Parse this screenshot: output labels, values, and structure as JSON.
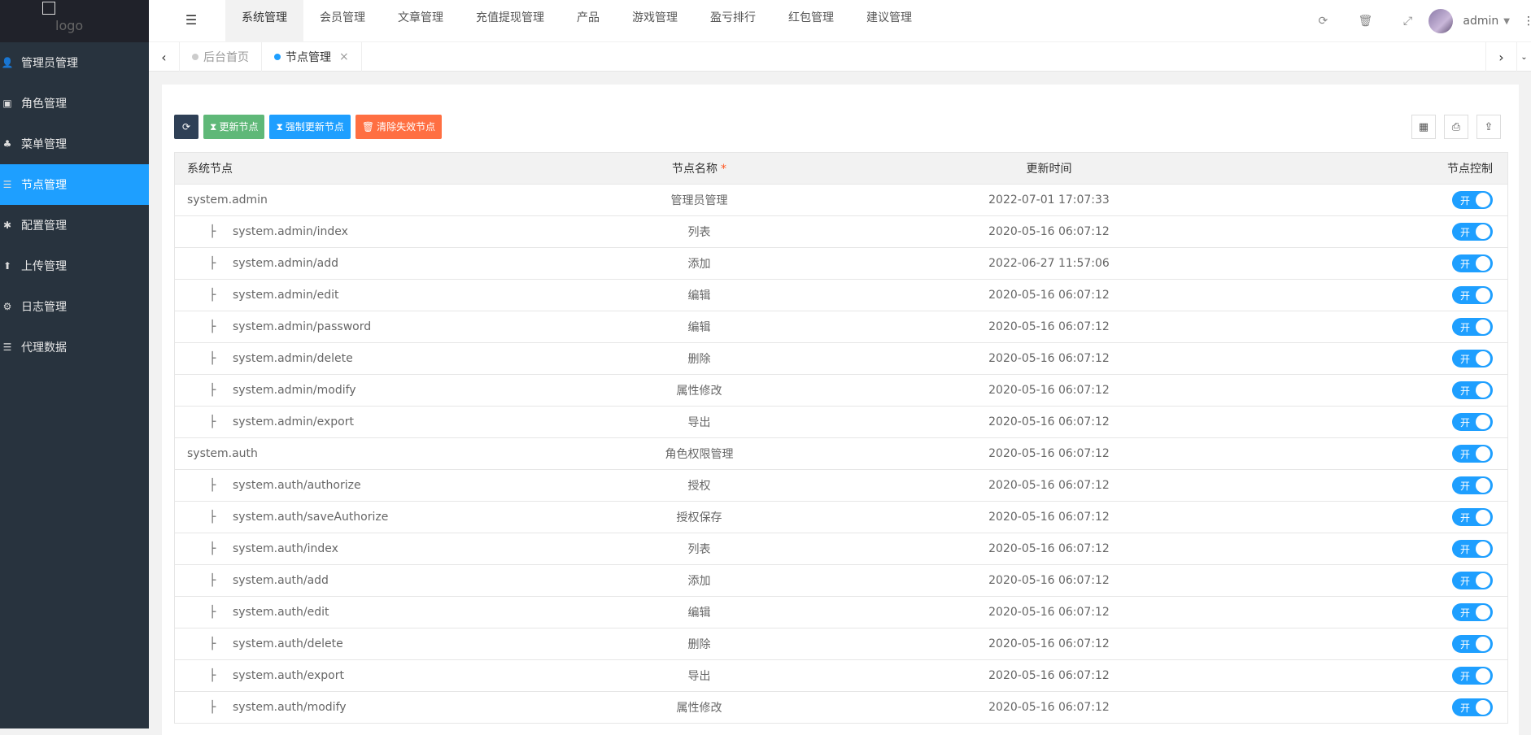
{
  "logo": {
    "text": "logo"
  },
  "sidebar": {
    "items": [
      {
        "label": "管理员管理",
        "icon": "user-icon"
      },
      {
        "label": "角色管理",
        "icon": "role-icon"
      },
      {
        "label": "菜单管理",
        "icon": "tree-icon"
      },
      {
        "label": "节点管理",
        "icon": "list-icon",
        "active": true
      },
      {
        "label": "配置管理",
        "icon": "asterisk-icon"
      },
      {
        "label": "上传管理",
        "icon": "upload-arrow-icon"
      },
      {
        "label": "日志管理",
        "icon": "log-icon"
      },
      {
        "label": "代理数据",
        "icon": "list-icon"
      }
    ]
  },
  "header": {
    "nav": [
      "系统管理",
      "会员管理",
      "文章管理",
      "充值提现管理",
      "产品",
      "游戏管理",
      "盈亏排行",
      "红包管理",
      "建议管理"
    ],
    "username": "admin"
  },
  "tabs": [
    {
      "label": "后台首页",
      "active": false
    },
    {
      "label": "节点管理",
      "active": true
    }
  ],
  "toolbar": {
    "update": "更新节点",
    "force_update": "强制更新节点",
    "clear": "清除失效节点"
  },
  "table": {
    "headers": {
      "node": "系统节点",
      "name": "节点名称",
      "time": "更新时间",
      "control": "节点控制"
    },
    "required_mark": "*",
    "tree_glyph": "├",
    "switch_label": "开",
    "rows": [
      {
        "node": "system.admin",
        "name": "管理员管理",
        "time": "2022-07-01 17:07:33",
        "child": false
      },
      {
        "node": "system.admin/index",
        "name": "列表",
        "time": "2020-05-16 06:07:12",
        "child": true
      },
      {
        "node": "system.admin/add",
        "name": "添加",
        "time": "2022-06-27 11:57:06",
        "child": true
      },
      {
        "node": "system.admin/edit",
        "name": "编辑",
        "time": "2020-05-16 06:07:12",
        "child": true
      },
      {
        "node": "system.admin/password",
        "name": "编辑",
        "time": "2020-05-16 06:07:12",
        "child": true
      },
      {
        "node": "system.admin/delete",
        "name": "删除",
        "time": "2020-05-16 06:07:12",
        "child": true
      },
      {
        "node": "system.admin/modify",
        "name": "属性修改",
        "time": "2020-05-16 06:07:12",
        "child": true
      },
      {
        "node": "system.admin/export",
        "name": "导出",
        "time": "2020-05-16 06:07:12",
        "child": true
      },
      {
        "node": "system.auth",
        "name": "角色权限管理",
        "time": "2020-05-16 06:07:12",
        "child": false
      },
      {
        "node": "system.auth/authorize",
        "name": "授权",
        "time": "2020-05-16 06:07:12",
        "child": true
      },
      {
        "node": "system.auth/saveAuthorize",
        "name": "授权保存",
        "time": "2020-05-16 06:07:12",
        "child": true
      },
      {
        "node": "system.auth/index",
        "name": "列表",
        "time": "2020-05-16 06:07:12",
        "child": true
      },
      {
        "node": "system.auth/add",
        "name": "添加",
        "time": "2020-05-16 06:07:12",
        "child": true
      },
      {
        "node": "system.auth/edit",
        "name": "编辑",
        "time": "2020-05-16 06:07:12",
        "child": true
      },
      {
        "node": "system.auth/delete",
        "name": "删除",
        "time": "2020-05-16 06:07:12",
        "child": true
      },
      {
        "node": "system.auth/export",
        "name": "导出",
        "time": "2020-05-16 06:07:12",
        "child": true
      },
      {
        "node": "system.auth/modify",
        "name": "属性修改",
        "time": "2020-05-16 06:07:12",
        "child": true
      }
    ]
  }
}
